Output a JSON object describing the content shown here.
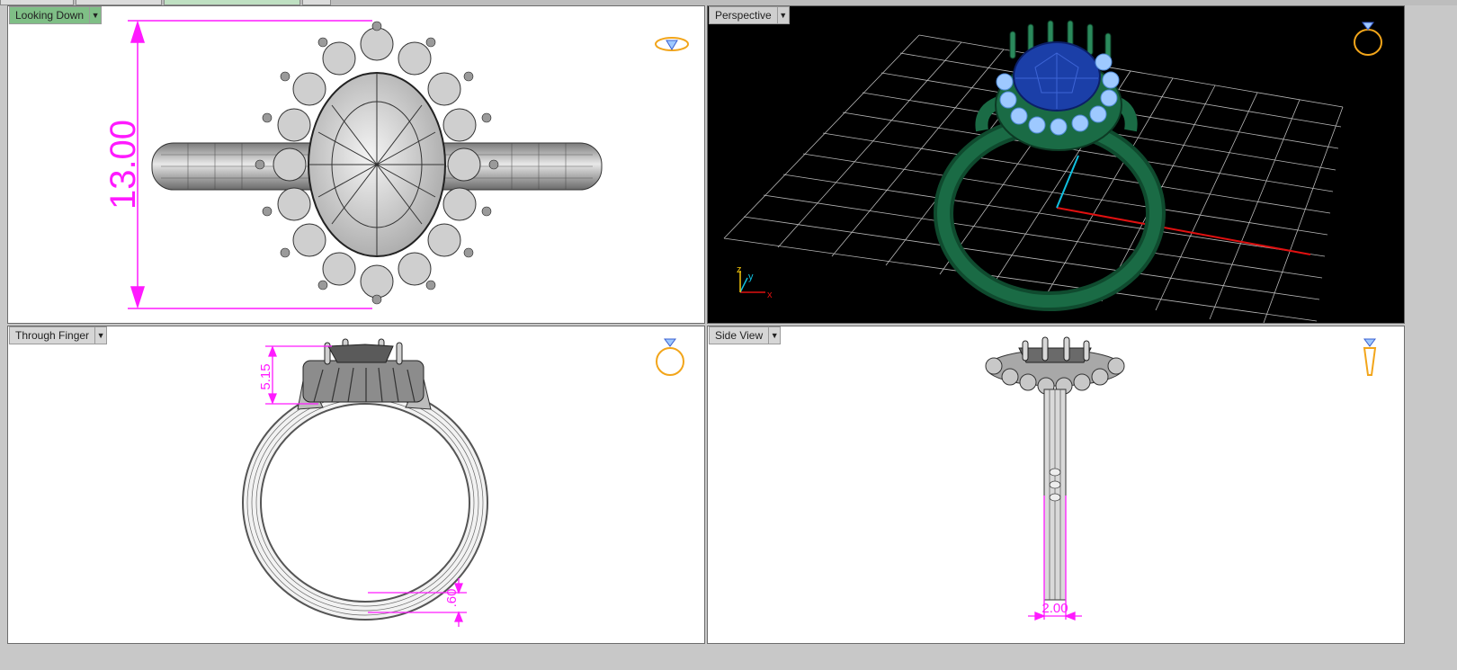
{
  "viewports": {
    "top_left": {
      "label": "Looking Down",
      "dimension": "13.00"
    },
    "top_right": {
      "label": "Perspective",
      "axes": {
        "x": "x",
        "y": "y",
        "z": "z"
      }
    },
    "bottom_left": {
      "label": "Through Finger",
      "dimension_head": "5.15",
      "dimension_band": ".60"
    },
    "bottom_right": {
      "label": "Side View",
      "dimension": "2.00"
    }
  },
  "colors": {
    "dimension": "#ff1aff",
    "active_label": "#7fbf86",
    "ring_green": "#1a6b45",
    "stone_blue": "#1b3fa8",
    "accent_stone": "#9ec9ff",
    "grid": "#d9d9d9",
    "axis_x": "#e01010",
    "axis_y": "#10c0e0",
    "view_icon": "#f2a51a"
  },
  "icons": {
    "top_left": "ring-top-view-icon",
    "top_right": "ring-perspective-icon",
    "bottom_left": "ring-front-view-icon",
    "bottom_right": "ring-side-view-icon"
  }
}
